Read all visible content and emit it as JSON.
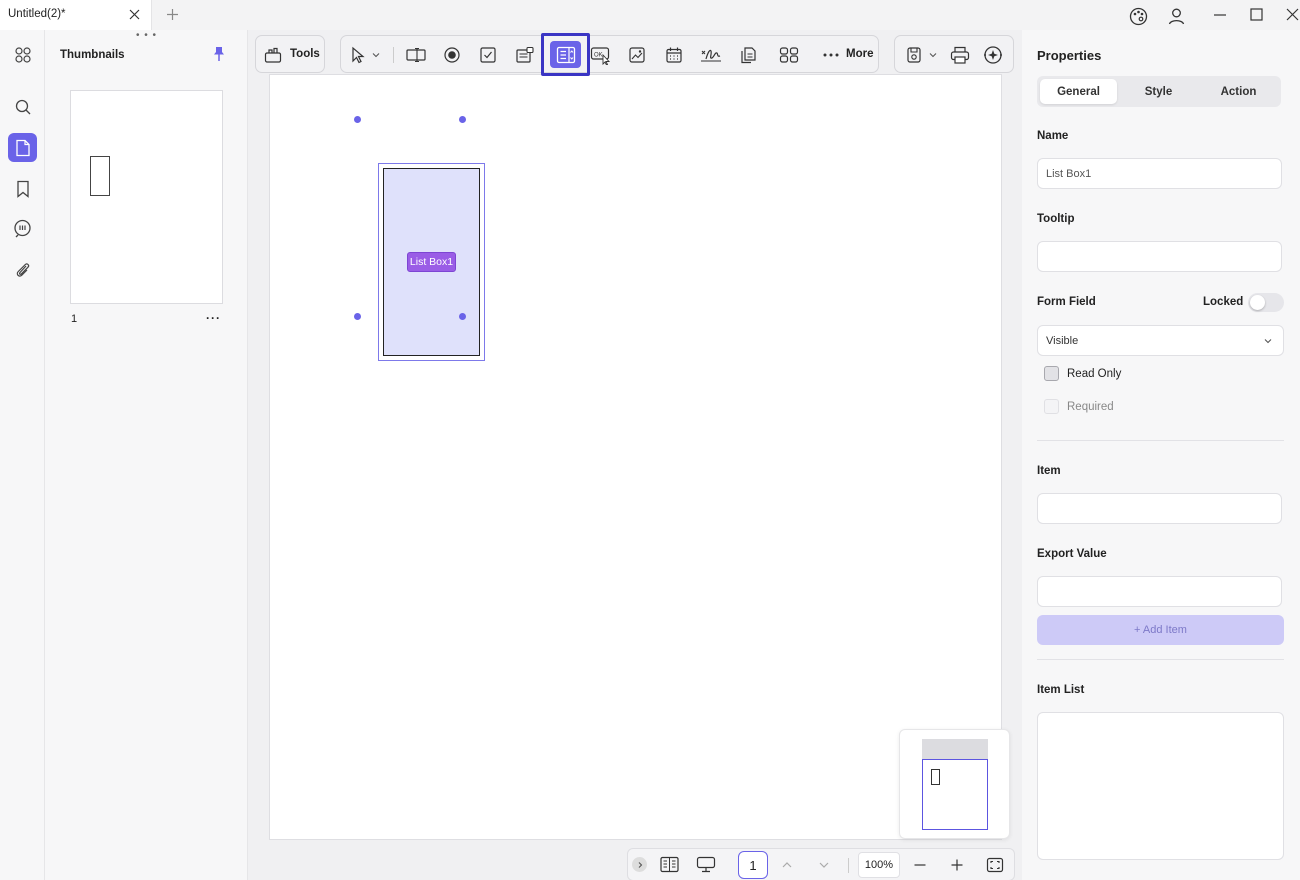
{
  "titlebar": {
    "tab_title": "Untitled(2)*"
  },
  "thumbnails": {
    "title": "Thumbnails",
    "page_number": "1",
    "more": "···"
  },
  "toolbar": {
    "tools_label": "Tools",
    "more_label": "More"
  },
  "canvas": {
    "field_label": "List Box1"
  },
  "bottombar": {
    "page": "1",
    "zoom": "100%"
  },
  "properties": {
    "title": "Properties",
    "tabs": [
      "General",
      "Style",
      "Action"
    ],
    "name_label": "Name",
    "name_value": "List Box1",
    "tooltip_label": "Tooltip",
    "tooltip_value": "",
    "form_field_label": "Form Field",
    "locked_label": "Locked",
    "visibility_value": "Visible",
    "read_only_label": "Read Only",
    "required_label": "Required",
    "item_label": "Item",
    "item_value": "",
    "export_value_label": "Export Value",
    "export_value": "",
    "add_item_label": "+ Add Item",
    "item_list_label": "Item List"
  },
  "colors": {
    "accent": "#6a63e8",
    "highlight": "#3a35c4",
    "field_fill": "#dfe1fb",
    "label_purple": "#9a5de6"
  }
}
